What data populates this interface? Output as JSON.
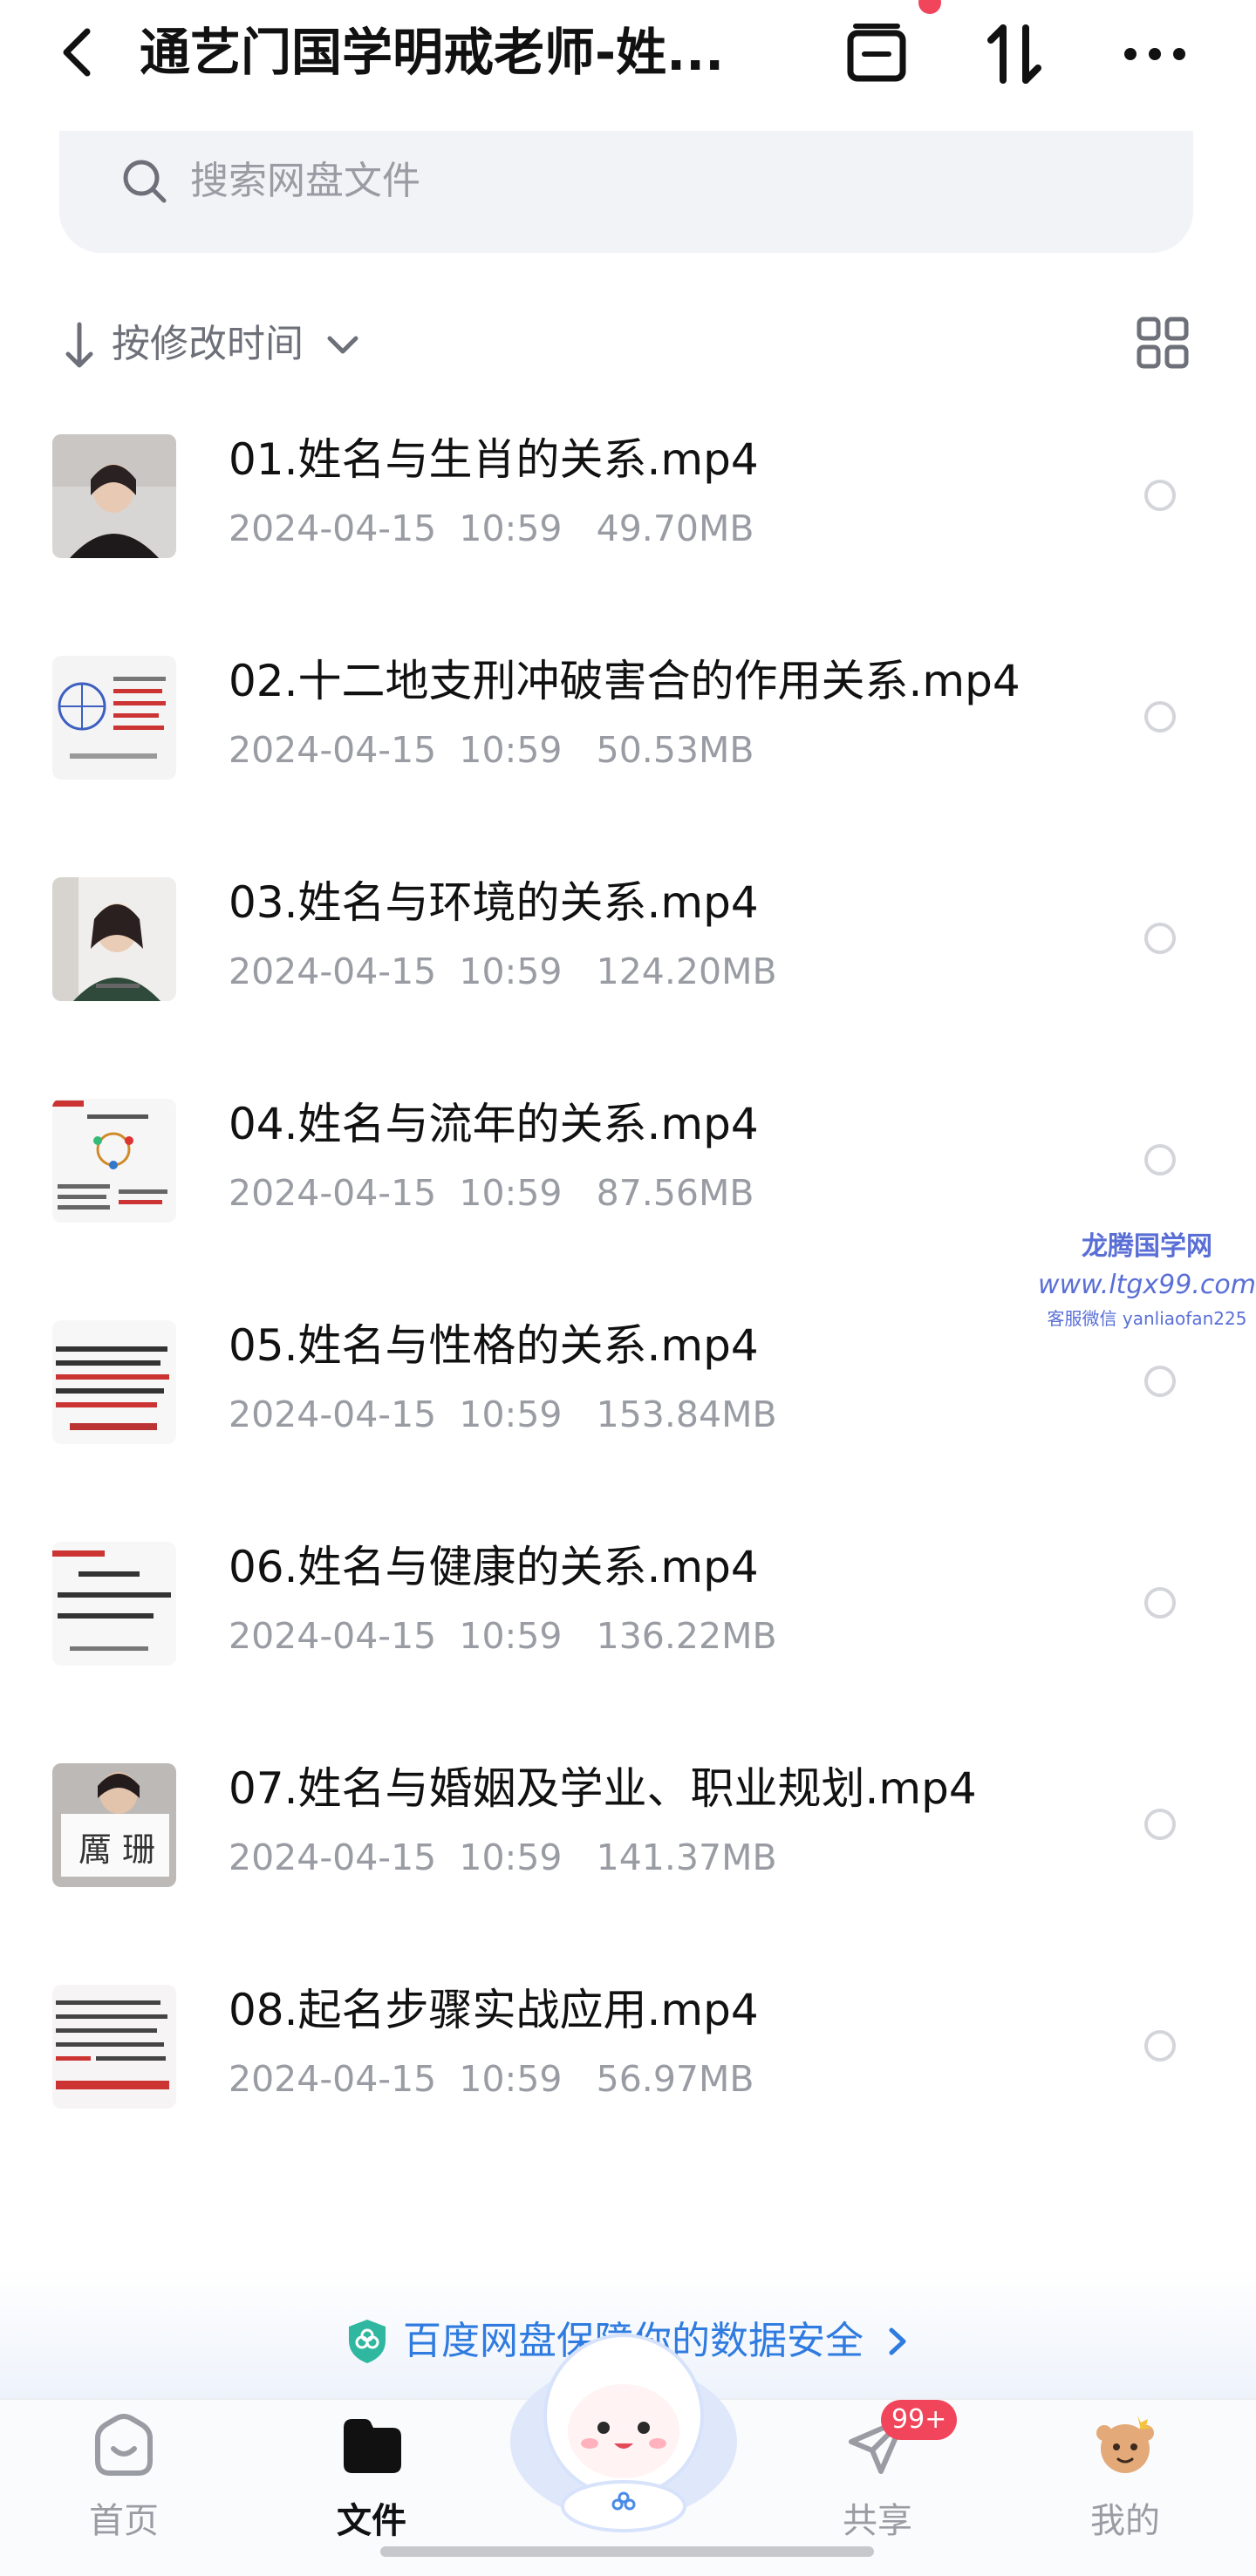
{
  "header": {
    "title": "通艺门国学明戒老师-姓...",
    "icons": [
      "back-icon",
      "transfer-box-icon",
      "sort-transfer-icon",
      "more-icon"
    ],
    "notification_dot_color": "#f0455a"
  },
  "search": {
    "placeholder": "搜索网盘文件"
  },
  "sort": {
    "label": "按修改时间"
  },
  "files": [
    {
      "name": "01.姓名与生肖的关系.mp4",
      "date": "2024-04-15",
      "time": "10:59",
      "size": "49.70MB",
      "thumb": "person"
    },
    {
      "name": "02.十二地支刑冲破害合的作用关系.mp4",
      "date": "2024-04-15",
      "time": "10:59",
      "size": "50.53MB",
      "thumb": "slide"
    },
    {
      "name": "03.姓名与环境的关系.mp4",
      "date": "2024-04-15",
      "time": "10:59",
      "size": "124.20MB",
      "thumb": "person"
    },
    {
      "name": "04.姓名与流年的关系.mp4",
      "date": "2024-04-15",
      "time": "10:59",
      "size": "87.56MB",
      "thumb": "slide"
    },
    {
      "name": "05.姓名与性格的关系.mp4",
      "date": "2024-04-15",
      "time": "10:59",
      "size": "153.84MB",
      "thumb": "slide"
    },
    {
      "name": "06.姓名与健康的关系.mp4",
      "date": "2024-04-15",
      "time": "10:59",
      "size": "136.22MB",
      "thumb": "slide"
    },
    {
      "name": "07.姓名与婚姻及学业、职业规划.mp4",
      "date": "2024-04-15",
      "time": "10:59",
      "size": "141.37MB",
      "thumb": "person"
    },
    {
      "name": "08.起名步骤实战应用.mp4",
      "date": "2024-04-15",
      "time": "10:59",
      "size": "56.97MB",
      "thumb": "slide"
    }
  ],
  "watermark": {
    "line1": "龙腾国学网",
    "line2": "www.ltgx99.com",
    "line3": "客服微信 yanliaofan225"
  },
  "safety_banner": {
    "text": "百度网盘保障你的数据安全"
  },
  "tabbar": {
    "tabs": [
      {
        "label": "首页",
        "icon": "home-icon",
        "active": false
      },
      {
        "label": "文件",
        "icon": "folder-icon",
        "active": true
      },
      {
        "label": "共享",
        "icon": "share-plane-icon",
        "active": false,
        "badge": "99+"
      },
      {
        "label": "我的",
        "icon": "avatar-icon",
        "active": false
      }
    ]
  },
  "colors": {
    "accent": "#2f7be0",
    "badge": "#f0455a",
    "muted": "#9a9ca4"
  }
}
